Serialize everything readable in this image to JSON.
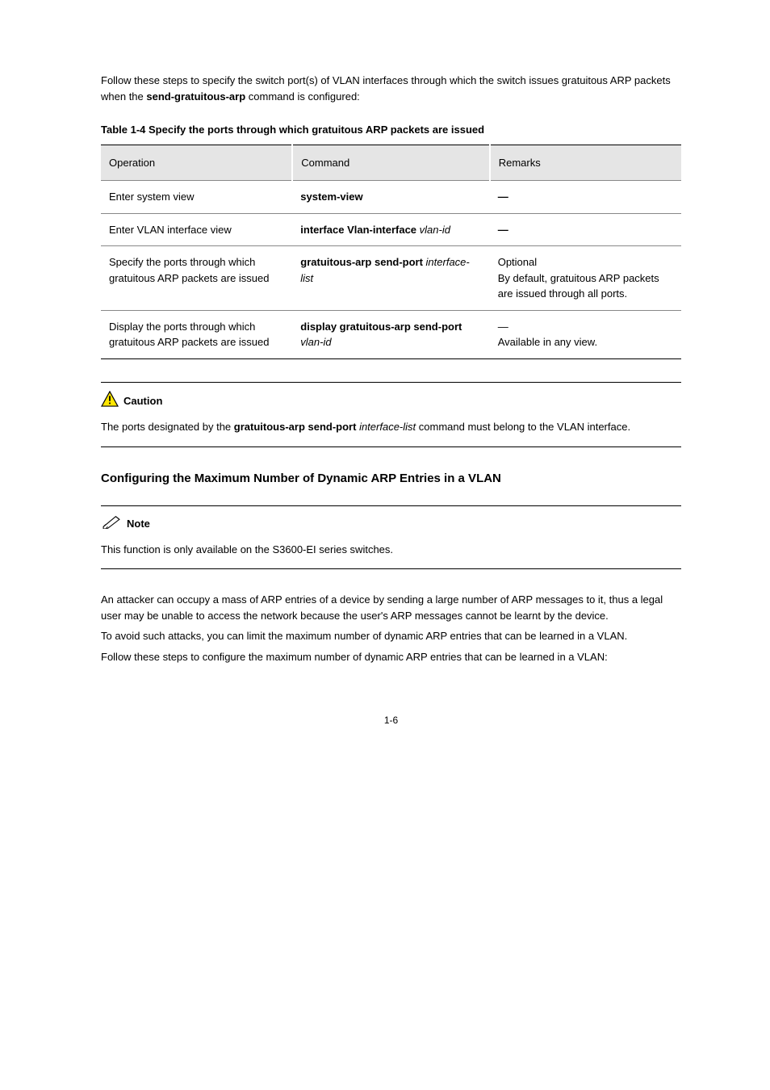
{
  "intro": {
    "p1_prefix": "Follow these steps to specify the switch port(s) of VLAN interfaces through which the switch issues gratuitous ARP packets when the ",
    "p1_cmd": "send-gratuitous-arp",
    "p1_suffix": " command is configured:"
  },
  "table_caption": "Table 1-4 Specify the ports through which gratuitous ARP packets are issued",
  "table": {
    "headers": [
      "Operation",
      "Command",
      "Remarks"
    ],
    "rows": [
      {
        "op": "Enter system view",
        "cmd_bold": "system-view",
        "cmd_arg": "",
        "rem_bold": true,
        "rem": "—"
      },
      {
        "op": "Enter VLAN interface view",
        "cmd_bold": "interface Vlan-interface ",
        "cmd_arg": "vlan-id",
        "rem_bold": true,
        "rem": "—"
      },
      {
        "op": "Specify the ports through which gratuitous ARP packets are issued",
        "cmd_bold": "gratuitous-arp send-port ",
        "cmd_arg": "interface-list",
        "rem_bold": false,
        "rem": "Optional\nBy default, gratuitous ARP packets are issued through all ports."
      },
      {
        "op": "Display the ports through which gratuitous ARP packets are issued",
        "cmd_bold": "display gratuitous-arp send-port ",
        "cmd_arg": "vlan-id",
        "rem_bold": false,
        "rem": "—\nAvailable in any view."
      }
    ]
  },
  "caution": {
    "label": "Caution",
    "prefix": "The ports designated by the ",
    "cmd": "gratuitous-arp send-port",
    "arg": " interface-list",
    "suffix": " command must belong to the VLAN interface."
  },
  "heading": "Configuring the Maximum Number of Dynamic ARP Entries in a VLAN",
  "note": {
    "label": "Note",
    "text": "This function is only available on the S3600-EI series switches."
  },
  "body": {
    "p1": "An attacker can occupy a mass of ARP entries of a device by sending a large number of ARP messages to it, thus a legal user may be unable to access the network because the user's ARP messages cannot be learnt by the device.",
    "p2": "To avoid such attacks, you can limit the maximum number of dynamic ARP entries that can be learned in a VLAN.",
    "p3": "Follow these steps to configure the maximum number of dynamic ARP entries that can be learned in a VLAN:"
  },
  "page_number": "1-6"
}
